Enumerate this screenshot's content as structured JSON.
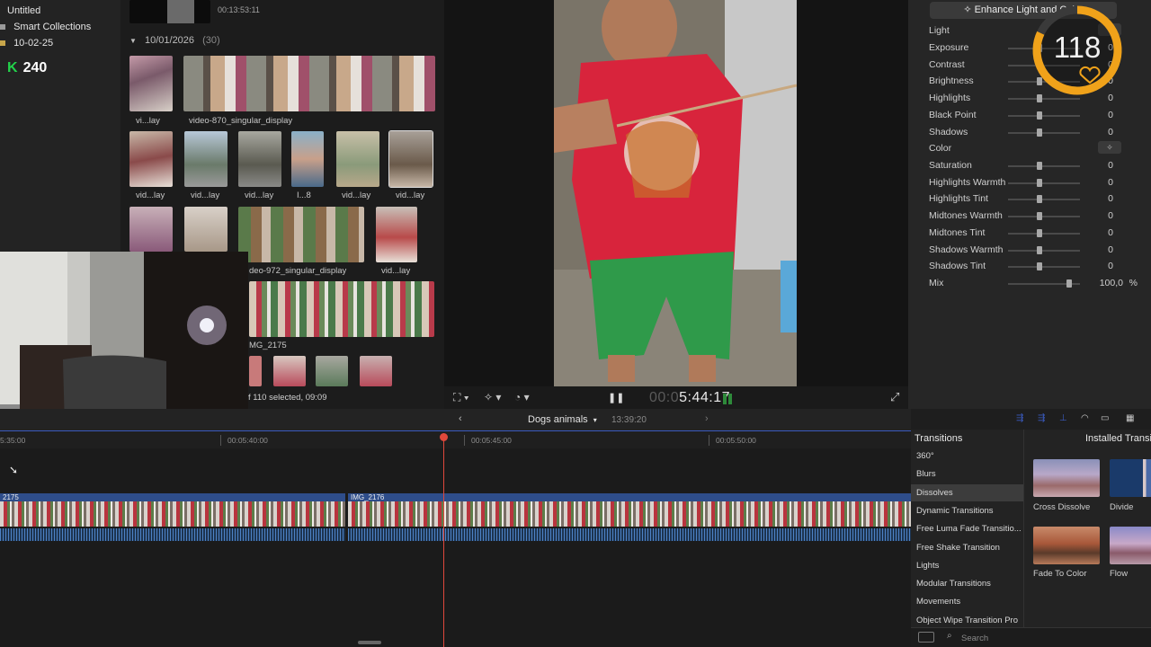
{
  "sidebar": {
    "items": [
      {
        "label": "Untitled"
      },
      {
        "label": "Smart Collections"
      },
      {
        "label": "10-02-25"
      }
    ],
    "badge": {
      "letter": "K",
      "value": "240"
    }
  },
  "browser": {
    "top_time": "00:13:53:11",
    "date_header": "10/01/2026",
    "date_count": "(30)",
    "clips": [
      {
        "label": "vi...lay"
      },
      {
        "label": "video-870_singular_display"
      },
      {
        "label": "vid...lay"
      },
      {
        "label": "vid...lay"
      },
      {
        "label": "vid...lay"
      },
      {
        "label": "I...8"
      },
      {
        "label": "vid...lay"
      },
      {
        "label": "vid...lay"
      },
      {
        "label": "deo-972_singular_display"
      },
      {
        "label": "vid...lay"
      },
      {
        "label": "MG_2175"
      }
    ],
    "selection_status": "f 110 selected, 09:09"
  },
  "viewer": {
    "timecode_dim": "00:0",
    "timecode": "5:44:17"
  },
  "inspector": {
    "enhance_label": "Enhance Light and Color",
    "light_label": "Light",
    "color_label": "Color",
    "light_rows": [
      {
        "label": "Exposure",
        "value": "0"
      },
      {
        "label": "Contrast",
        "value": "0"
      },
      {
        "label": "Brightness",
        "value": "0"
      },
      {
        "label": "Highlights",
        "value": "0"
      },
      {
        "label": "Black Point",
        "value": "0"
      },
      {
        "label": "Shadows",
        "value": "0"
      }
    ],
    "color_rows": [
      {
        "label": "Saturation",
        "value": "0"
      },
      {
        "label": "Highlights Warmth",
        "value": "0"
      },
      {
        "label": "Highlights Tint",
        "value": "0"
      },
      {
        "label": "Midtones Warmth",
        "value": "0"
      },
      {
        "label": "Midtones Tint",
        "value": "0"
      },
      {
        "label": "Shadows Warmth",
        "value": "0"
      },
      {
        "label": "Shadows Tint",
        "value": "0"
      }
    ],
    "mix": {
      "label": "Mix",
      "value": "100,0",
      "unit": "%"
    }
  },
  "gauge": {
    "value": "118",
    "level": 0.82,
    "color": "#f0a21a"
  },
  "timeline": {
    "project_name": "Dogs animals",
    "project_duration": "13:39:20",
    "ruler_ticks": [
      "5:35:00",
      "00:05:40:00",
      "00:05:45:00",
      "00:05:50:00"
    ],
    "clips": [
      {
        "name": "2175"
      },
      {
        "name": "IMG_2176"
      }
    ]
  },
  "transitions": {
    "header": "Transitions",
    "installed_header": "Installed Transitions",
    "categories": [
      {
        "label": "360°"
      },
      {
        "label": "Blurs"
      },
      {
        "label": "Dissolves",
        "selected": true
      },
      {
        "label": "Dynamic Transitions"
      },
      {
        "label": "Free Luma Fade Transitio..."
      },
      {
        "label": "Free Shake Transition"
      },
      {
        "label": "Lights"
      },
      {
        "label": "Modular Transitions"
      },
      {
        "label": "Movements"
      },
      {
        "label": "Object Wipe Transition Pro"
      }
    ],
    "items": [
      {
        "label": "Cross Dissolve"
      },
      {
        "label": "Divide"
      },
      {
        "label": "Fade To Color"
      },
      {
        "label": "Flow"
      }
    ],
    "search_placeholder": "Search"
  },
  "colors": {
    "playhead": "#e0483b",
    "accent_blue": "#3a5bc0",
    "gauge": "#f0a21a"
  }
}
